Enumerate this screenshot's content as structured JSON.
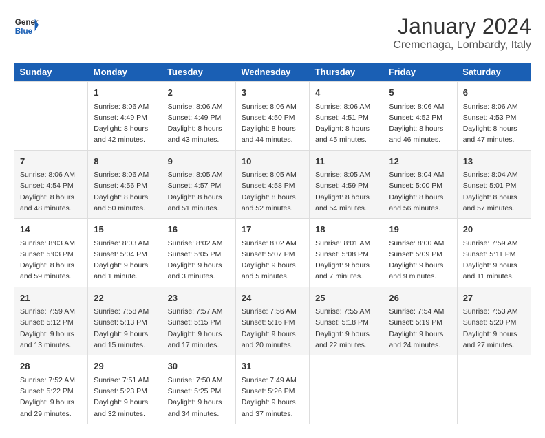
{
  "logo": {
    "line1": "General",
    "line2": "Blue"
  },
  "title": "January 2024",
  "subtitle": "Cremenaga, Lombardy, Italy",
  "days_header": [
    "Sunday",
    "Monday",
    "Tuesday",
    "Wednesday",
    "Thursday",
    "Friday",
    "Saturday"
  ],
  "weeks": [
    [
      {
        "day": "",
        "info": ""
      },
      {
        "day": "1",
        "info": "Sunrise: 8:06 AM\nSunset: 4:49 PM\nDaylight: 8 hours\nand 42 minutes."
      },
      {
        "day": "2",
        "info": "Sunrise: 8:06 AM\nSunset: 4:49 PM\nDaylight: 8 hours\nand 43 minutes."
      },
      {
        "day": "3",
        "info": "Sunrise: 8:06 AM\nSunset: 4:50 PM\nDaylight: 8 hours\nand 44 minutes."
      },
      {
        "day": "4",
        "info": "Sunrise: 8:06 AM\nSunset: 4:51 PM\nDaylight: 8 hours\nand 45 minutes."
      },
      {
        "day": "5",
        "info": "Sunrise: 8:06 AM\nSunset: 4:52 PM\nDaylight: 8 hours\nand 46 minutes."
      },
      {
        "day": "6",
        "info": "Sunrise: 8:06 AM\nSunset: 4:53 PM\nDaylight: 8 hours\nand 47 minutes."
      }
    ],
    [
      {
        "day": "7",
        "info": "Sunrise: 8:06 AM\nSunset: 4:54 PM\nDaylight: 8 hours\nand 48 minutes."
      },
      {
        "day": "8",
        "info": "Sunrise: 8:06 AM\nSunset: 4:56 PM\nDaylight: 8 hours\nand 50 minutes."
      },
      {
        "day": "9",
        "info": "Sunrise: 8:05 AM\nSunset: 4:57 PM\nDaylight: 8 hours\nand 51 minutes."
      },
      {
        "day": "10",
        "info": "Sunrise: 8:05 AM\nSunset: 4:58 PM\nDaylight: 8 hours\nand 52 minutes."
      },
      {
        "day": "11",
        "info": "Sunrise: 8:05 AM\nSunset: 4:59 PM\nDaylight: 8 hours\nand 54 minutes."
      },
      {
        "day": "12",
        "info": "Sunrise: 8:04 AM\nSunset: 5:00 PM\nDaylight: 8 hours\nand 56 minutes."
      },
      {
        "day": "13",
        "info": "Sunrise: 8:04 AM\nSunset: 5:01 PM\nDaylight: 8 hours\nand 57 minutes."
      }
    ],
    [
      {
        "day": "14",
        "info": "Sunrise: 8:03 AM\nSunset: 5:03 PM\nDaylight: 8 hours\nand 59 minutes."
      },
      {
        "day": "15",
        "info": "Sunrise: 8:03 AM\nSunset: 5:04 PM\nDaylight: 9 hours\nand 1 minute."
      },
      {
        "day": "16",
        "info": "Sunrise: 8:02 AM\nSunset: 5:05 PM\nDaylight: 9 hours\nand 3 minutes."
      },
      {
        "day": "17",
        "info": "Sunrise: 8:02 AM\nSunset: 5:07 PM\nDaylight: 9 hours\nand 5 minutes."
      },
      {
        "day": "18",
        "info": "Sunrise: 8:01 AM\nSunset: 5:08 PM\nDaylight: 9 hours\nand 7 minutes."
      },
      {
        "day": "19",
        "info": "Sunrise: 8:00 AM\nSunset: 5:09 PM\nDaylight: 9 hours\nand 9 minutes."
      },
      {
        "day": "20",
        "info": "Sunrise: 7:59 AM\nSunset: 5:11 PM\nDaylight: 9 hours\nand 11 minutes."
      }
    ],
    [
      {
        "day": "21",
        "info": "Sunrise: 7:59 AM\nSunset: 5:12 PM\nDaylight: 9 hours\nand 13 minutes."
      },
      {
        "day": "22",
        "info": "Sunrise: 7:58 AM\nSunset: 5:13 PM\nDaylight: 9 hours\nand 15 minutes."
      },
      {
        "day": "23",
        "info": "Sunrise: 7:57 AM\nSunset: 5:15 PM\nDaylight: 9 hours\nand 17 minutes."
      },
      {
        "day": "24",
        "info": "Sunrise: 7:56 AM\nSunset: 5:16 PM\nDaylight: 9 hours\nand 20 minutes."
      },
      {
        "day": "25",
        "info": "Sunrise: 7:55 AM\nSunset: 5:18 PM\nDaylight: 9 hours\nand 22 minutes."
      },
      {
        "day": "26",
        "info": "Sunrise: 7:54 AM\nSunset: 5:19 PM\nDaylight: 9 hours\nand 24 minutes."
      },
      {
        "day": "27",
        "info": "Sunrise: 7:53 AM\nSunset: 5:20 PM\nDaylight: 9 hours\nand 27 minutes."
      }
    ],
    [
      {
        "day": "28",
        "info": "Sunrise: 7:52 AM\nSunset: 5:22 PM\nDaylight: 9 hours\nand 29 minutes."
      },
      {
        "day": "29",
        "info": "Sunrise: 7:51 AM\nSunset: 5:23 PM\nDaylight: 9 hours\nand 32 minutes."
      },
      {
        "day": "30",
        "info": "Sunrise: 7:50 AM\nSunset: 5:25 PM\nDaylight: 9 hours\nand 34 minutes."
      },
      {
        "day": "31",
        "info": "Sunrise: 7:49 AM\nSunset: 5:26 PM\nDaylight: 9 hours\nand 37 minutes."
      },
      {
        "day": "",
        "info": ""
      },
      {
        "day": "",
        "info": ""
      },
      {
        "day": "",
        "info": ""
      }
    ]
  ]
}
